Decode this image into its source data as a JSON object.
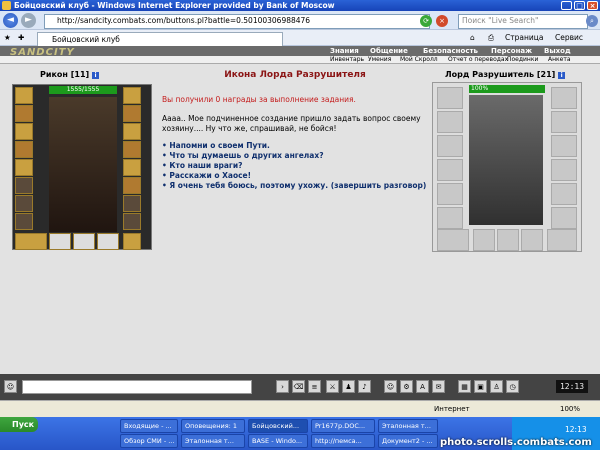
{
  "window": {
    "title": "Бойцовский клуб - Windows Internet Explorer provided by Bank of Moscow"
  },
  "browser": {
    "address": "http://sandcity.combats.com/buttons.pl?battle=0.50100306988476",
    "search_placeholder": "Поиск \"Live Search\"",
    "tab_title": "Бойцовский клуб",
    "toolbar": {
      "page": "Страница",
      "service": "Сервис"
    }
  },
  "site": {
    "logo": "SANDCITY",
    "top_menu": [
      "Знания",
      "Общение",
      "Безопасность",
      "Персонаж",
      "Выход"
    ],
    "sub_menu": [
      "Инвентарь",
      "Умения",
      "Мой Скролл",
      "Отчет о переводах",
      "Поединки",
      "Анкета"
    ]
  },
  "player": {
    "name": "Рикон",
    "level": "[11]",
    "hp": "1555/1555"
  },
  "dialog": {
    "title": "Икона Лорда Разрушителя",
    "rewards": "Вы получили 0 награды за выполнение задания.",
    "speech": "Аааа.. Мое подчиненное создание пришло задать вопрос своему хозяину.... Ну что же, спрашивай, не бойся!",
    "options": [
      "Напомни о своем Пути.",
      "Что ты думаешь о других ангелах?",
      "Кто наши враги?",
      "Расскажи о Хаосе!",
      "Я очень тебя боюсь, поэтому ухожу. (завершить разговор)"
    ]
  },
  "boss": {
    "name": "Лорд Разрушитель",
    "level": "[21]",
    "hp": "100%"
  },
  "chat": {
    "clock": "12:13"
  },
  "status": {
    "zone": "Интернет",
    "zoom": "100%"
  },
  "taskbar": {
    "start": "Пуск",
    "tasks_row1": [
      "Входящие - ...",
      "Оповещения: 1",
      "Бойцовский...",
      "Pr1677p.DOC...",
      "Эталонная т..."
    ],
    "tasks_row2": [
      "Обзор СМИ - ...",
      "Эталонная т...",
      "BASE - Windo...",
      "http://пемса...",
      "Документ2 - ..."
    ],
    "clock": "12:13"
  },
  "watermark": "photo.scrolls.combats.com"
}
